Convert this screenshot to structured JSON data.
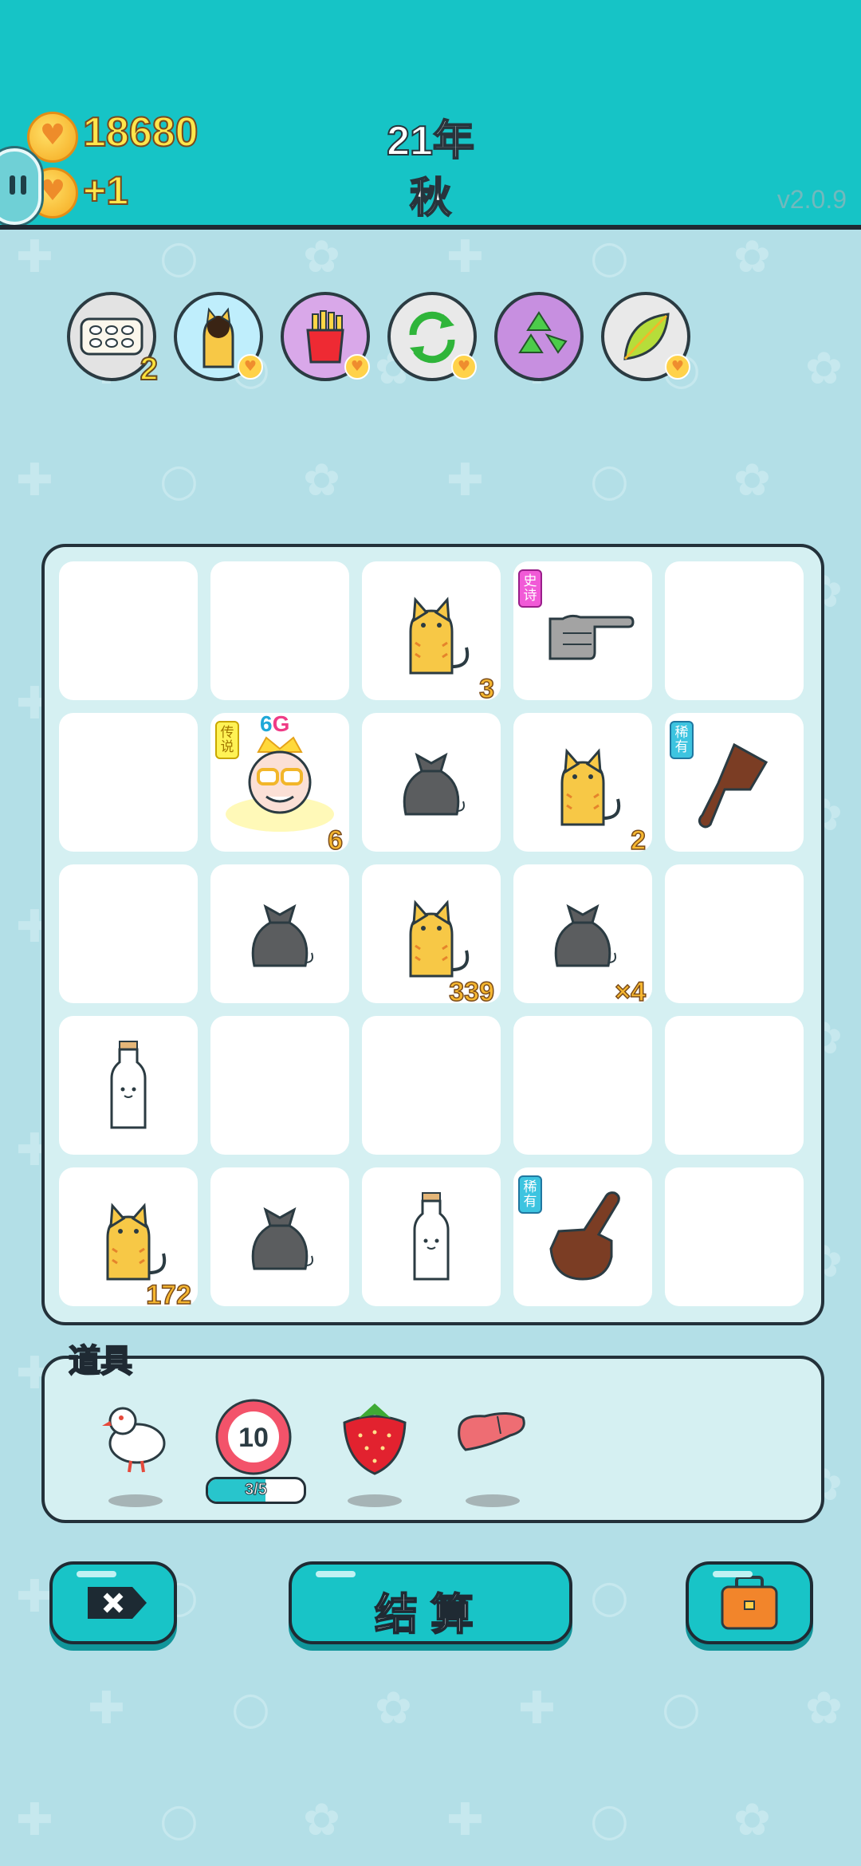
{
  "header": {
    "coins": "18680",
    "coin_rate": "+1",
    "year": "21年",
    "season": "秋",
    "version": "v2.0.9"
  },
  "buffs": [
    {
      "name": "egg-tray-icon",
      "count": "2",
      "bg": "#e3e3e3"
    },
    {
      "name": "cat-icon",
      "bg": "#bfeefc"
    },
    {
      "name": "fries-icon",
      "bg": "#d9a8e9"
    },
    {
      "name": "refresh-icon",
      "bg": "#e9e9e9"
    },
    {
      "name": "recycle-icon",
      "bg": "#c78fe0"
    },
    {
      "name": "leaf-icon",
      "bg": "#e9e9e9"
    }
  ],
  "board": {
    "cells": [
      {
        "row": 0,
        "col": 0,
        "item": null
      },
      {
        "row": 0,
        "col": 1,
        "item": null
      },
      {
        "row": 0,
        "col": 2,
        "item": "cat",
        "label": "3"
      },
      {
        "row": 0,
        "col": 3,
        "item": "gray-hand",
        "tag": "史诗"
      },
      {
        "row": 0,
        "col": 4,
        "item": null
      },
      {
        "row": 1,
        "col": 0,
        "item": null
      },
      {
        "row": 1,
        "col": 1,
        "item": "king",
        "label": "6",
        "tag": "传说",
        "level": "6G"
      },
      {
        "row": 1,
        "col": 2,
        "item": "trash-bag"
      },
      {
        "row": 1,
        "col": 3,
        "item": "cat",
        "label": "2"
      },
      {
        "row": 1,
        "col": 4,
        "item": "brown-hand-down",
        "tag": "稀有"
      },
      {
        "row": 2,
        "col": 0,
        "item": null
      },
      {
        "row": 2,
        "col": 1,
        "item": "trash-bag"
      },
      {
        "row": 2,
        "col": 2,
        "item": "cat",
        "label": "339"
      },
      {
        "row": 2,
        "col": 3,
        "item": "trash-bag",
        "label": "×4"
      },
      {
        "row": 2,
        "col": 4,
        "item": null
      },
      {
        "row": 3,
        "col": 0,
        "item": "milk-bottle"
      },
      {
        "row": 3,
        "col": 1,
        "item": null
      },
      {
        "row": 3,
        "col": 2,
        "item": null
      },
      {
        "row": 3,
        "col": 3,
        "item": null
      },
      {
        "row": 3,
        "col": 4,
        "item": null
      },
      {
        "row": 4,
        "col": 0,
        "item": "cat",
        "label": "172"
      },
      {
        "row": 4,
        "col": 1,
        "item": "trash-bag"
      },
      {
        "row": 4,
        "col": 2,
        "item": "milk-bottle"
      },
      {
        "row": 4,
        "col": 3,
        "item": "brown-hand-up",
        "tag": "稀有"
      },
      {
        "row": 4,
        "col": 4,
        "item": null
      }
    ]
  },
  "props": {
    "title": "道具",
    "items": [
      {
        "name": "pigeon-icon"
      },
      {
        "name": "timer-ten-icon",
        "value": "10",
        "progress_text": "3/5",
        "progress": 0.6
      },
      {
        "name": "strawberry-icon"
      },
      {
        "name": "liver-icon"
      }
    ]
  },
  "buttons": {
    "settle": "结算"
  }
}
